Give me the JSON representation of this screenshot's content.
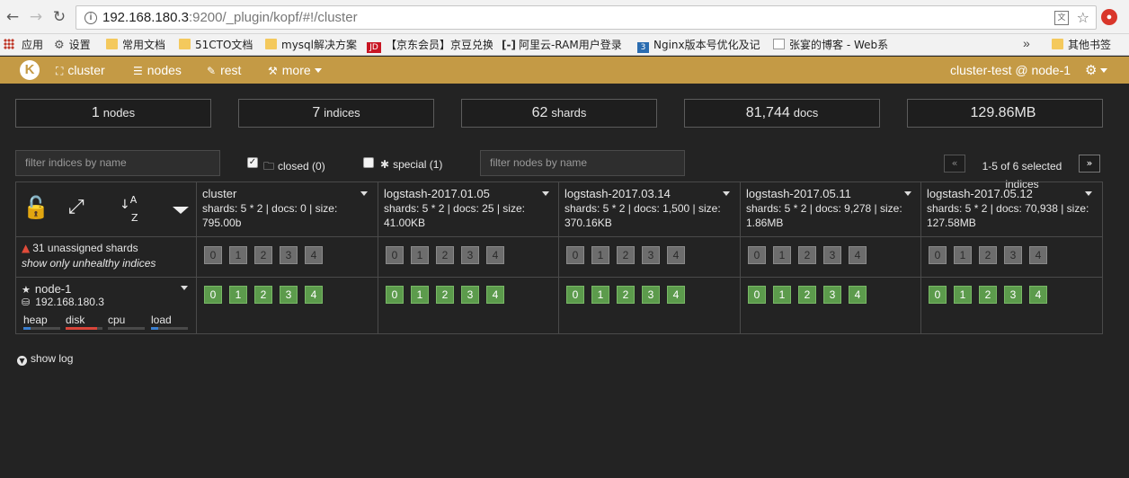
{
  "browser": {
    "url_host": "192.168.180.3",
    "url_rest": ":9200/_plugin/kopf/#!/cluster",
    "bookmarks": [
      {
        "label": "应用",
        "icon": "apps-grid-icon"
      },
      {
        "label": "设置",
        "icon": "gear-icon"
      },
      {
        "label": "常用文档",
        "icon": "folder-icon"
      },
      {
        "label": "51CTO文档",
        "icon": "folder-icon"
      },
      {
        "label": "mysql解决方案",
        "icon": "folder-icon"
      },
      {
        "label": "【京东会员】京豆兑换",
        "icon": "jd-icon"
      },
      {
        "label": "阿里云-RAM用户登录",
        "icon": "aliyun-icon"
      },
      {
        "label": "Nginx版本号优化及记",
        "icon": "nginx-icon"
      },
      {
        "label": "张宴的博客 - Web系",
        "icon": "blog-page-icon"
      }
    ],
    "bookmarks_more": "»",
    "other_bookmarks": "其他书签"
  },
  "navbar": {
    "logo": "K",
    "items": [
      {
        "label": "cluster",
        "icon": "sitemap-icon"
      },
      {
        "label": "nodes",
        "icon": "list-icon"
      },
      {
        "label": "rest",
        "icon": "edit-icon"
      },
      {
        "label": "more",
        "icon": "magic-wand-icon"
      }
    ],
    "cluster_info": "cluster-test @ node-1"
  },
  "stats": [
    {
      "value": "1",
      "label": "nodes"
    },
    {
      "value": "7",
      "label": "indices"
    },
    {
      "value": "62",
      "label": "shards"
    },
    {
      "value": "81,744",
      "label": "docs"
    },
    {
      "value": "129.86MB",
      "label": ""
    }
  ],
  "filters": {
    "indices_placeholder": "filter indices by name",
    "closed_label": "closed (0)",
    "closed_checked": true,
    "special_label": "special (1)",
    "special_checked": false,
    "nodes_placeholder": "filter nodes by name"
  },
  "pagination": {
    "prev": "«",
    "next": "»",
    "text": "1-5 of 6 selected indices"
  },
  "table": {
    "indices": [
      {
        "name": "cluster",
        "info": "shards: 5 * 2 | docs: 0 | size: 795.00b"
      },
      {
        "name": "logstash-2017.01.05",
        "info": "shards: 5 * 2 | docs: 25 | size: 41.00KB"
      },
      {
        "name": "logstash-2017.03.14",
        "info": "shards: 5 * 2 | docs: 1,500 | size: 370.16KB"
      },
      {
        "name": "logstash-2017.05.11",
        "info": "shards: 5 * 2 | docs: 9,278 | size: 1.86MB"
      },
      {
        "name": "logstash-2017.05.12",
        "info": "shards: 5 * 2 | docs: 70,938 | size: 127.58MB"
      }
    ],
    "shard_ids": [
      "0",
      "1",
      "2",
      "3",
      "4"
    ],
    "unassigned_label": "31 unassigned shards",
    "unhealthy_label": "show only unhealthy indices",
    "node": {
      "name": "node-1",
      "ip": "192.168.180.3",
      "metrics": [
        {
          "label": "heap",
          "level": 0.2,
          "color": "#3a7fd0"
        },
        {
          "label": "disk",
          "level": 0.85,
          "color": "#d9453a"
        },
        {
          "label": "cpu",
          "level": 0.0,
          "color": "#3a7fd0"
        },
        {
          "label": "load",
          "level": 0.2,
          "color": "#3a7fd0"
        }
      ]
    }
  },
  "show_log": "show log",
  "colors": {
    "navbar": "#c49a45",
    "background": "#232323",
    "shard_started": "#5c9b4c",
    "shard_unassigned": "#6d6d6d",
    "warning": "#e04b3a"
  }
}
